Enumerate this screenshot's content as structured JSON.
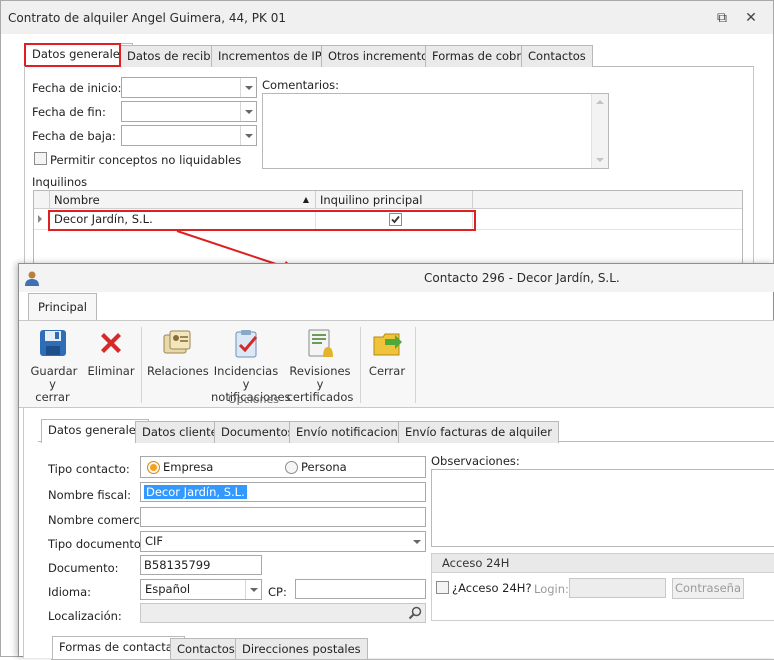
{
  "back_window": {
    "title": "Contrato de alquiler Angel Guimera, 44, PK 01",
    "tabs": [
      "Datos generales",
      "Datos de recibo",
      "Incrementos de IPC",
      "Otros incrementos",
      "Formas de cobro",
      "Contactos"
    ],
    "active_tab": "Datos generales",
    "fields": {
      "fecha_inicio_label": "Fecha de inicio:",
      "fecha_fin_label": "Fecha de fin:",
      "fecha_baja_label": "Fecha de baja:",
      "comentarios_label": "Comentarios:",
      "permitir_label": "Permitir conceptos no liquidables"
    },
    "inquilinos": {
      "section_label": "Inquilinos",
      "columns": [
        "Nombre",
        "Inquilino principal"
      ],
      "rows": [
        {
          "nombre": "Decor Jardín, S.L.",
          "principal": true
        }
      ]
    }
  },
  "front_window": {
    "title": "Contacto 296 - Decor Jardín, S.L.",
    "ribbon_tab": "Principal",
    "ribbon_buttons": {
      "guardar": "Guardar y cerrar",
      "eliminar": "Eliminar",
      "relaciones": "Relaciones",
      "incidencias": "Incidencias y notificaciones",
      "revisiones": "Revisiones y certificados",
      "cerrar": "Cerrar"
    },
    "ribbon_group": "Opciones",
    "tabs": [
      "Datos generales",
      "Datos cliente",
      "Documentos",
      "Envío notificaciones",
      "Envío facturas de alquiler"
    ],
    "active_tab": "Datos generales",
    "form": {
      "tipo_contacto_label": "Tipo contacto:",
      "tipo_options": [
        "Empresa",
        "Persona"
      ],
      "tipo_selected": "Empresa",
      "nombre_fiscal_label": "Nombre fiscal:",
      "nombre_fiscal": "Decor Jardín, S.L.",
      "nombre_comercial_label": "Nombre comercial:",
      "nombre_comercial": "",
      "tipo_documento_label": "Tipo documento:",
      "tipo_documento": "CIF",
      "documento_label": "Documento:",
      "documento": "B58135799",
      "idioma_label": "Idioma:",
      "idioma": "Español",
      "cp_label": "CP:",
      "cp": "",
      "localizacion_label": "Localización:",
      "observaciones_label": "Observaciones:"
    },
    "acceso": {
      "group_label": "Acceso 24H",
      "check_label": "¿Acceso 24H?",
      "login_label": "Login:",
      "password_button": "Contraseña"
    },
    "sub_tabs": [
      "Formas de contactar",
      "Contactos",
      "Direcciones postales"
    ],
    "sub_active": "Formas de contactar"
  },
  "colors": {
    "highlight_red": "#e02020",
    "radio_accent": "#f3a21d",
    "selection_blue": "#3399ff"
  }
}
